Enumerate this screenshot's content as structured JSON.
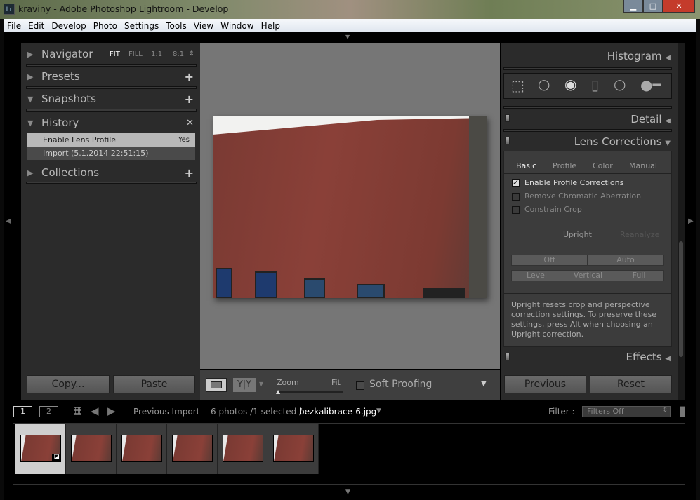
{
  "window": {
    "title": "kraviny - Adobe Photoshop Lightroom - Develop",
    "logo": "Lr",
    "minimize": "▁",
    "maximize": "□",
    "close": "✕"
  },
  "menu": [
    "File",
    "Edit",
    "Develop",
    "Photo",
    "Settings",
    "Tools",
    "View",
    "Window",
    "Help"
  ],
  "left": {
    "navigator": {
      "label": "Navigator",
      "zoom": [
        "FIT",
        "FILL",
        "1:1",
        "8:1"
      ]
    },
    "presets": {
      "label": "Presets"
    },
    "snapshots": {
      "label": "Snapshots"
    },
    "history": {
      "label": "History",
      "items": [
        {
          "label": "Enable Lens Profile",
          "value": "Yes"
        },
        {
          "label": "Import (5.1.2014 22:51:15)",
          "value": ""
        }
      ]
    },
    "collections": {
      "label": "Collections"
    },
    "copy": "Copy...",
    "paste": "Paste"
  },
  "toolbar": {
    "zoom_label": "Zoom",
    "zoom_value": "Fit",
    "soft_proofing": "Soft Proofing",
    "soft_proofing_checked": false
  },
  "right": {
    "histogram": "Histogram",
    "detail": "Detail",
    "lens": "Lens Corrections",
    "tabs": [
      "Basic",
      "Profile",
      "Color",
      "Manual"
    ],
    "checks": [
      {
        "label": "Enable Profile Corrections",
        "checked": true
      },
      {
        "label": "Remove Chromatic Aberration",
        "checked": false
      },
      {
        "label": "Constrain Crop",
        "checked": false
      }
    ],
    "upright": "Upright",
    "reanalyze": "Reanalyze",
    "upright_buttons": [
      "Off",
      "Auto",
      "Level",
      "Vertical",
      "Full"
    ],
    "info": "Upright resets crop and perspective correction settings. To preserve these settings, press Alt when choosing an Upright correction.",
    "effects": "Effects",
    "previous": "Previous",
    "reset": "Reset"
  },
  "filmstrip": {
    "view1": "1",
    "view2": "2",
    "source": "Previous Import",
    "count": "6 photos /1 selected /",
    "filename": "bezkalibrace-6.jpg",
    "filter_label": "Filter :",
    "filter_value": "Filters Off",
    "selected_index": 0,
    "thumb_count": 6
  }
}
